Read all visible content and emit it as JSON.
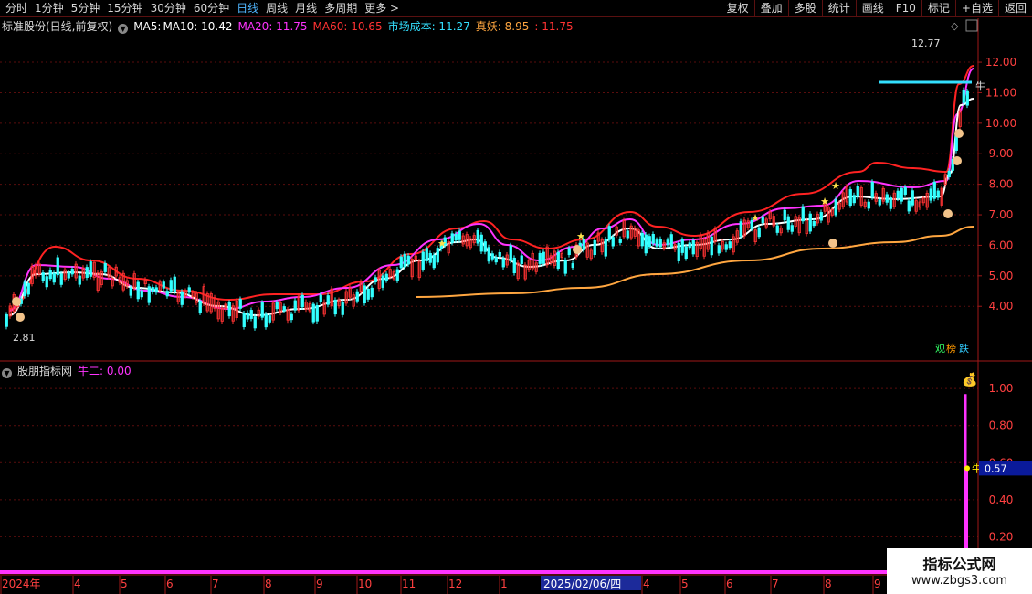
{
  "toolbar": {
    "periods": [
      "分时",
      "1分钟",
      "5分钟",
      "15分钟",
      "30分钟",
      "60分钟",
      "日线",
      "周线",
      "月线",
      "多周期",
      "更多 >"
    ],
    "active_period": "日线",
    "right_buttons": [
      "复权",
      "叠加",
      "多股",
      "统计",
      "画线",
      "F10",
      "+自选",
      "返回"
    ],
    "mark_button": "标记"
  },
  "main_legend": {
    "title": "标准股份(日线,前复权)",
    "items": [
      {
        "label": "MA5:",
        "color": "#ffffff"
      },
      {
        "label": "MA10: 10.42",
        "color": "#ffffff"
      },
      {
        "label": "MA20: 11.75",
        "color": "#ff33ff"
      },
      {
        "label": "MA60: 10.65",
        "color": "#ff3333"
      },
      {
        "label": "市场成本: 11.27",
        "color": "#33e0ff"
      },
      {
        "label": "真妖: 8.95",
        "color": "#ffa640"
      },
      {
        "label": ": 11.75",
        "color": "#ff3333"
      }
    ]
  },
  "sub_legend": {
    "title": "股朋指标网",
    "items": [
      {
        "label": "牛二: 0.00",
        "color": "#ff33ff"
      }
    ]
  },
  "main_axis": {
    "ticks": [
      "12.00",
      "11.00",
      "10.00",
      "9.00",
      "8.00",
      "7.00",
      "6.00",
      "5.00",
      "4.00"
    ],
    "values": [
      12,
      11,
      10,
      9,
      8,
      7,
      6,
      5,
      4
    ],
    "min": 2.3,
    "max": 12.9
  },
  "sub_axis": {
    "ticks": [
      "1.00",
      "0.80",
      "0.60",
      "0.40",
      "0.20"
    ],
    "values": [
      1.0,
      0.8,
      0.6,
      0.4,
      0.2
    ],
    "min": 0.0,
    "max": 1.05,
    "current": "0.57"
  },
  "price_labels": {
    "high": "12.77",
    "low": "2.81"
  },
  "bottom_axis": {
    "labels": [
      "2024年",
      "4",
      "5",
      "6",
      "7",
      "8",
      "9",
      "10",
      "11",
      "12",
      "1",
      "4",
      "5",
      "6",
      "7",
      "8",
      "9"
    ],
    "date_highlight": "2025/02/06/四"
  },
  "marker_text": {
    "niu": "牛",
    "guan": "观",
    "bang": "榜",
    "die": "跌"
  },
  "watermark": {
    "line1": "指标公式网",
    "line2": "www.zbgs3.com"
  },
  "colors": {
    "up": "#ff3333",
    "down": "#33ffff",
    "ma_white": "#ffffff",
    "ma_magenta": "#ff33ff",
    "ma_red": "#ff2222",
    "cost": "#33e0ff",
    "orange": "#ffa640"
  }
}
